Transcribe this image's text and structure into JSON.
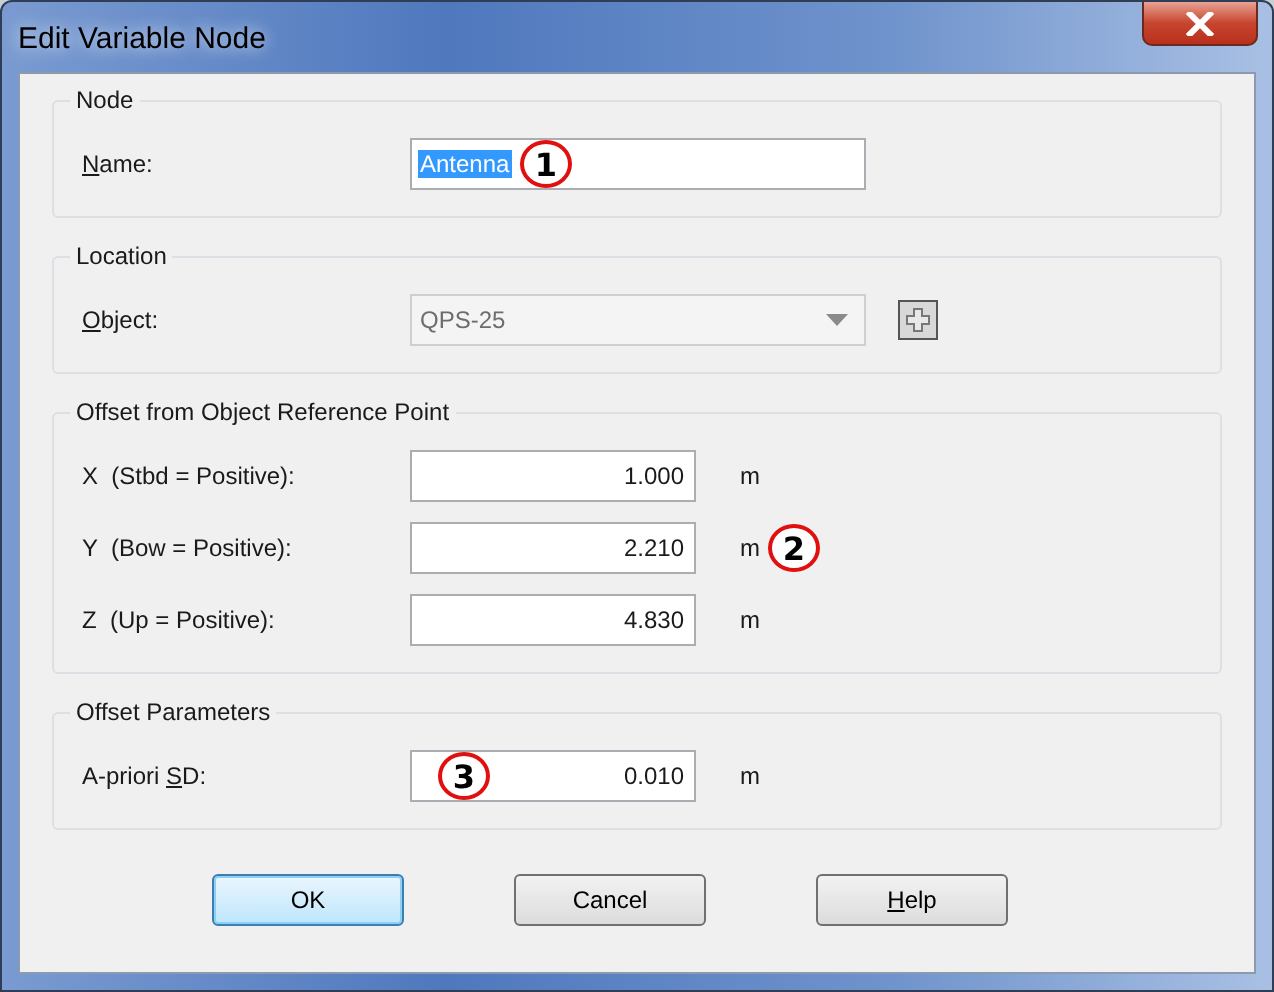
{
  "window": {
    "title": "Edit Variable Node"
  },
  "groups": [
    {
      "title": "Node",
      "rows": [
        {
          "kind": "text",
          "label": [
            {
              "text": "N",
              "underlined": true
            },
            {
              "text": "ame:",
              "underlined": false
            }
          ],
          "value": "Antenna",
          "value_selected": true,
          "callout": {
            "text": "1",
            "kind": "after_value"
          }
        }
      ]
    },
    {
      "title": "Location",
      "rows": [
        {
          "kind": "combo",
          "label": [
            {
              "text": "O",
              "underlined": true
            },
            {
              "text": "bject:",
              "underlined": false
            }
          ],
          "value": "QPS-25",
          "disabled": true
        }
      ]
    },
    {
      "title": "Offset from Object Reference Point",
      "rows": [
        {
          "kind": "number",
          "label": [
            {
              "text": "X  (Stbd = Positive):",
              "underlined": false
            }
          ],
          "value": "1.000",
          "unit": "m"
        },
        {
          "kind": "number",
          "label": [
            {
              "text": "Y  (Bow = Positive):",
              "underlined": false
            }
          ],
          "value": "2.210",
          "unit": "m",
          "callout": {
            "text": "2",
            "kind": "after_unit"
          }
        },
        {
          "kind": "number",
          "label": [
            {
              "text": "Z  (Up = Positive):",
              "underlined": false
            }
          ],
          "value": "4.830",
          "unit": "m"
        }
      ]
    },
    {
      "title": "Offset Parameters",
      "rows": [
        {
          "kind": "number",
          "label": [
            {
              "text": "A-priori ",
              "underlined": false
            },
            {
              "text": "S",
              "underlined": true
            },
            {
              "text": "D:",
              "underlined": false
            }
          ],
          "value": "0.010",
          "unit": "m",
          "callout": {
            "text": "3",
            "kind": "in_field"
          }
        }
      ]
    }
  ],
  "buttons": [
    {
      "label": [
        {
          "text": "OK",
          "underlined": false
        }
      ],
      "default": true
    },
    {
      "label": [
        {
          "text": "Cancel",
          "underlined": false
        }
      ],
      "default": false
    },
    {
      "label": [
        {
          "text": "H",
          "underlined": true
        },
        {
          "text": "elp",
          "underlined": false
        }
      ],
      "default": false
    }
  ]
}
